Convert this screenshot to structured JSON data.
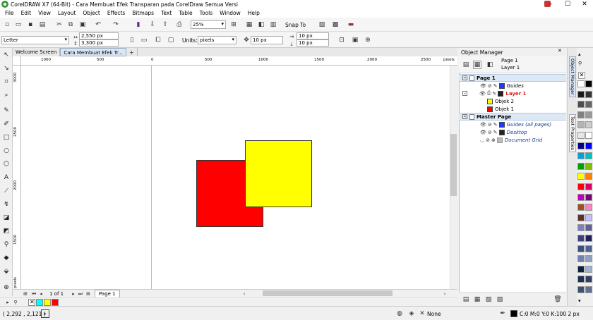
{
  "window": {
    "title": "CorelDRAW X7 (64-Bit) - Cara Membuat Efek Transparan pada CorelDraw Semua Versi"
  },
  "menu": [
    "File",
    "Edit",
    "View",
    "Layout",
    "Object",
    "Effects",
    "Bitmaps",
    "Text",
    "Table",
    "Tools",
    "Window",
    "Help"
  ],
  "toolbar": {
    "zoom": "25%",
    "snap_to": "Snap To"
  },
  "property_bar": {
    "paper_size": "Letter",
    "width": "2,550 px",
    "height": "3,300 px",
    "units_label": "Units:",
    "units_value": "pixels",
    "nudge": "10 px",
    "dup_x": "10 px",
    "dup_y": "10 px"
  },
  "tabs": [
    "Welcome Screen",
    "Cara Membuat Efek Tr..."
  ],
  "ruler": {
    "h_labels": [
      "1000",
      "500",
      "0",
      "500",
      "1000",
      "1500",
      "2000",
      "2500"
    ],
    "h_unit": "pixels",
    "v_labels": [
      "3000",
      "2500",
      "2000",
      "1500",
      "1000"
    ],
    "v_unit": "pixels"
  },
  "page_nav": {
    "counter": "1 of 1",
    "page_tab": "Page 1"
  },
  "status": {
    "coords": "( 2,292 , 2,121 )",
    "fill": "None",
    "outline": "C:0 M:0 Y:0 K:100  2 px"
  },
  "object_manager": {
    "title": "Object Manager",
    "current_page": "Page 1",
    "current_layer": "Layer 1",
    "page1": {
      "label": "Page 1",
      "guides": "Guides",
      "layer1": "Layer 1",
      "obj2": "Objek 2",
      "obj1": "Objek 1"
    },
    "master": {
      "label": "Master Page",
      "guides": "Guides (all pages)",
      "desktop": "Desktop",
      "grid": "Document Grid"
    }
  },
  "docker_tabs": [
    "Object Manager",
    "Text Properties"
  ],
  "colors": {
    "red": "#ff0000",
    "yellow": "#ffff00",
    "guides_blue": "#1a3cff",
    "layer_red": "#e02020",
    "desktop_dark": "#222222",
    "grid_gray": "#bbbbbb"
  },
  "document_palette": [
    "#00ffff",
    "#ffff00",
    "#ff0000"
  ],
  "color_palette": [
    "#ffffff",
    "#000000",
    "#1a1a1a",
    "#333333",
    "#4d4d4d",
    "#666666",
    "#808080",
    "#999999",
    "#b3b3b3",
    "#cccccc",
    "#e6e6e6",
    "#ffffff",
    "#000080",
    "#0000ff",
    "#00a0e0",
    "#00c0c0",
    "#00a000",
    "#80c000",
    "#ffff00",
    "#ff8000",
    "#ff0000",
    "#e00060",
    "#c000c0",
    "#800080",
    "#a05020",
    "#ff80c0",
    "#603030",
    "#c0c0ff",
    "#8080c0",
    "#6060a0",
    "#404080",
    "#202060",
    "#3c5080",
    "#506090",
    "#7080b0",
    "#90a0c0",
    "#102040",
    "#a0b0d0",
    "#1e3050",
    "#304060",
    "#405070",
    "#607090"
  ]
}
